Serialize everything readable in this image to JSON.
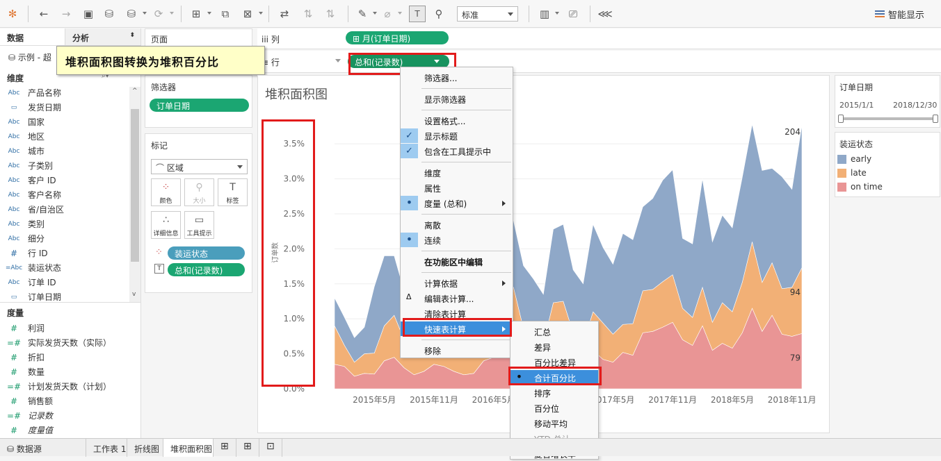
{
  "toolbar": {
    "fit_value": "标准",
    "show_me": "智能显示"
  },
  "datapane": {
    "tab_data": "数据",
    "tab_analysis": "分析",
    "datasource": "示例 - 超",
    "dimensions_header": "维度",
    "measures_header": "度量",
    "dimensions": [
      {
        "type": "Abc",
        "name": "产品名称"
      },
      {
        "type": "date",
        "name": "发货日期"
      },
      {
        "type": "Abc",
        "name": "国家"
      },
      {
        "type": "Abc",
        "name": "地区"
      },
      {
        "type": "Abc",
        "name": "城市"
      },
      {
        "type": "Abc",
        "name": "子类别"
      },
      {
        "type": "Abc",
        "name": "客户 ID"
      },
      {
        "type": "Abc",
        "name": "客户名称"
      },
      {
        "type": "Abc",
        "name": "省/自治区"
      },
      {
        "type": "Abc",
        "name": "类别"
      },
      {
        "type": "Abc",
        "name": "细分"
      },
      {
        "type": "#",
        "name": "行 ID"
      },
      {
        "type": "=Abc",
        "name": "装运状态"
      },
      {
        "type": "Abc",
        "name": "订单 ID"
      },
      {
        "type": "date",
        "name": "订单日期"
      }
    ],
    "measures": [
      {
        "type": "#",
        "name": "利润"
      },
      {
        "type": "=#",
        "name": "实际发货天数（实际）"
      },
      {
        "type": "#",
        "name": "折扣"
      },
      {
        "type": "#",
        "name": "数量"
      },
      {
        "type": "=#",
        "name": "计划发货天数（计划）"
      },
      {
        "type": "#",
        "name": "销售额"
      },
      {
        "type": "=#",
        "name": "记录数"
      },
      {
        "type": "#",
        "name": "度量值"
      }
    ]
  },
  "annotation": "堆积面积图转换为堆积百分比",
  "shelves": {
    "pages_label": "页面",
    "filters_label": "筛选器",
    "filter_pill": "订单日期",
    "marks_label": "标记",
    "mark_type": "区域",
    "mark_buttons": [
      "颜色",
      "大小",
      "标签",
      "详细信息",
      "工具提示"
    ],
    "mark_pills": [
      "装运状态",
      "总和(记录数)"
    ],
    "columns_label": "列",
    "rows_label": "行",
    "columns_pill": "月(订单日期)",
    "rows_pill": "总和(记录数)"
  },
  "context_menu": [
    {
      "label": "筛选器...",
      "state": ""
    },
    {
      "sep": true
    },
    {
      "label": "显示筛选器",
      "state": ""
    },
    {
      "sep": true
    },
    {
      "label": "设置格式...",
      "state": ""
    },
    {
      "label": "显示标题",
      "state": "check"
    },
    {
      "label": "包含在工具提示中",
      "state": "check"
    },
    {
      "sep": true
    },
    {
      "label": "维度",
      "state": ""
    },
    {
      "label": "属性",
      "state": ""
    },
    {
      "label": "度量 (总和)",
      "state": "dot",
      "sub": true
    },
    {
      "sep": true
    },
    {
      "label": "离散",
      "state": ""
    },
    {
      "label": "连续",
      "state": "dot"
    },
    {
      "sep": true
    },
    {
      "label": "在功能区中编辑",
      "state": "",
      "bold": true
    },
    {
      "sep": true
    },
    {
      "label": "计算依据",
      "state": "",
      "sub": true
    },
    {
      "label": "编辑表计算...",
      "state": "delta"
    },
    {
      "label": "清除表计算",
      "state": ""
    },
    {
      "label": "快速表计算",
      "state": "hover",
      "sub": true
    },
    {
      "sep": true
    },
    {
      "label": "移除",
      "state": ""
    }
  ],
  "sub_menu": [
    {
      "label": "汇总",
      "state": ""
    },
    {
      "label": "差异",
      "state": ""
    },
    {
      "label": "百分比差异",
      "state": ""
    },
    {
      "label": "合计百分比",
      "state": "dotsel"
    },
    {
      "label": "排序",
      "state": ""
    },
    {
      "label": "百分位",
      "state": ""
    },
    {
      "label": "移动平均",
      "state": ""
    },
    {
      "label": "YTD 总计",
      "state": "disabled"
    },
    {
      "label": "复合增长率",
      "state": ""
    }
  ],
  "chart_data": {
    "type": "area",
    "title": "堆积面积图",
    "ylabel": "订单数",
    "ytick_labels": [
      "0.0%",
      "0.5%",
      "1.0%",
      "1.5%",
      "2.0%",
      "2.5%",
      "3.0%",
      "3.5%"
    ],
    "ylim": [
      0,
      3.7
    ],
    "xtick_labels": [
      "2015年5月",
      "2015年11月",
      "2016年5月",
      "2016年11月",
      "2017年5月",
      "2017年11月",
      "2018年5月",
      "2018年11月"
    ],
    "x": [
      "2015-01",
      "2015-02",
      "2015-03",
      "2015-04",
      "2015-05",
      "2015-06",
      "2015-07",
      "2015-08",
      "2015-09",
      "2015-10",
      "2015-11",
      "2015-12",
      "2016-01",
      "2016-02",
      "2016-03",
      "2016-04",
      "2016-05",
      "2016-06",
      "2016-07",
      "2016-08",
      "2016-09",
      "2016-10",
      "2016-11",
      "2016-12",
      "2017-01",
      "2017-02",
      "2017-03",
      "2017-04",
      "2017-05",
      "2017-06",
      "2017-07",
      "2017-08",
      "2017-09",
      "2017-10",
      "2017-11",
      "2017-12",
      "2018-01",
      "2018-02",
      "2018-03",
      "2018-04",
      "2018-05",
      "2018-06",
      "2018-07",
      "2018-08",
      "2018-09",
      "2018-10",
      "2018-11",
      "2018-12"
    ],
    "series": [
      {
        "name": "on time",
        "color": "#e99595",
        "values": [
          0.35,
          0.32,
          0.18,
          0.22,
          0.21,
          0.4,
          0.45,
          0.3,
          0.2,
          0.25,
          0.35,
          0.32,
          0.25,
          0.2,
          0.22,
          0.4,
          0.45,
          0.7,
          0.6,
          0.38,
          0.32,
          0.3,
          0.58,
          0.55,
          0.4,
          0.35,
          0.55,
          0.42,
          0.38,
          0.52,
          0.48,
          0.8,
          0.82,
          0.88,
          0.95,
          0.7,
          0.62,
          0.9,
          0.55,
          0.65,
          0.58,
          0.8,
          1.15,
          0.82,
          1.05,
          0.78,
          0.75,
          0.79
        ]
      },
      {
        "name": "late",
        "color": "#f2b076",
        "values": [
          0.55,
          0.3,
          0.2,
          0.28,
          0.3,
          0.5,
          0.6,
          0.4,
          0.25,
          0.3,
          0.45,
          0.4,
          0.3,
          0.3,
          0.35,
          0.55,
          0.6,
          0.6,
          0.85,
          0.48,
          0.45,
          0.35,
          0.65,
          0.7,
          0.4,
          0.3,
          0.55,
          0.52,
          0.4,
          0.4,
          0.45,
          0.6,
          0.6,
          0.65,
          0.68,
          0.45,
          0.4,
          0.55,
          0.4,
          0.58,
          0.52,
          0.72,
          0.95,
          0.7,
          0.75,
          0.65,
          0.7,
          0.94
        ]
      },
      {
        "name": "early",
        "color": "#8fa8c8",
        "values": [
          0.4,
          0.4,
          0.35,
          0.38,
          0.95,
          1.0,
          0.85,
          0.7,
          0.55,
          0.6,
          0.9,
          0.95,
          0.8,
          0.6,
          0.7,
          1.35,
          1.4,
          1.2,
          0.95,
          0.9,
          0.8,
          0.7,
          1.05,
          1.1,
          0.9,
          0.85,
          1.25,
          1.08,
          1.0,
          1.3,
          1.2,
          1.2,
          1.3,
          1.45,
          1.5,
          1.0,
          1.05,
          1.55,
          1.15,
          1.25,
          1.2,
          1.5,
          1.68,
          1.6,
          1.35,
          1.6,
          1.4,
          2.04
        ]
      }
    ],
    "end_labels": [
      "204",
      "94",
      "79"
    ]
  },
  "right": {
    "filter_title": "订单日期",
    "range_start": "2015/1/1",
    "range_end": "2018/12/30",
    "legend_title": "装运状态",
    "legend": [
      {
        "name": "early",
        "color": "#8fa8c8"
      },
      {
        "name": "late",
        "color": "#f2b076"
      },
      {
        "name": "on time",
        "color": "#e99595"
      }
    ]
  },
  "bottom_tabs": [
    "数据源",
    "工作表 1",
    "折线图",
    "堆积面积图"
  ]
}
